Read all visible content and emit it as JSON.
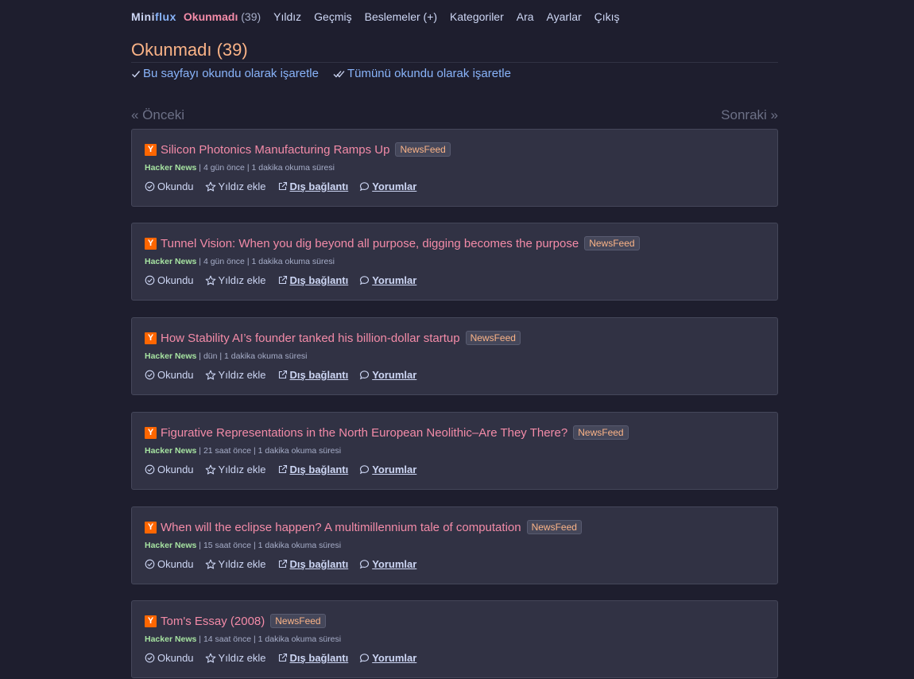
{
  "logo": {
    "part1": "Mini",
    "part2": "flux"
  },
  "nav": {
    "unread_label": "Okunmadı",
    "unread_count": "(39)",
    "items": [
      "Yıldız",
      "Geçmiş",
      "Beslemeler (+)",
      "Kategoriler",
      "Ara",
      "Ayarlar",
      "Çıkış"
    ]
  },
  "page_title": "Okunmadı (39)",
  "page_actions": [
    "Bu sayfayı okundu olarak işaretle",
    "Tümünü okundu olarak işaretle"
  ],
  "pager": {
    "prev": "« Önceki",
    "next": "Sonraki »"
  },
  "entry_icon_letter": "Y",
  "entry_actions": {
    "read": "Okundu",
    "star": "Yıldız ekle",
    "external": "Dış bağlantı",
    "comments": "Yorumlar"
  },
  "entries": [
    {
      "title": "Silicon Photonics Manufacturing Ramps Up",
      "tag": "NewsFeed",
      "feed": "Hacker News",
      "time": "4 gün önce",
      "reading": "1 dakika okuma süresi"
    },
    {
      "title": "Tunnel Vision: When you dig beyond all purpose, digging becomes the purpose",
      "tag": "NewsFeed",
      "feed": "Hacker News",
      "time": "4 gün önce",
      "reading": "1 dakika okuma süresi"
    },
    {
      "title": "How Stability AI’s founder tanked his billion-dollar startup",
      "tag": "NewsFeed",
      "feed": "Hacker News",
      "time": "dün",
      "reading": "1 dakika okuma süresi"
    },
    {
      "title": "Figurative Representations in the North European Neolithic–Are They There?",
      "tag": "NewsFeed",
      "feed": "Hacker News",
      "time": "21 saat önce",
      "reading": "1 dakika okuma süresi"
    },
    {
      "title": "When will the eclipse happen? A multimillennium tale of computation",
      "tag": "NewsFeed",
      "feed": "Hacker News",
      "time": "15 saat önce",
      "reading": "1 dakika okuma süresi"
    },
    {
      "title": "Tom's Essay (2008)",
      "tag": "NewsFeed",
      "feed": "Hacker News",
      "time": "14 saat önce",
      "reading": "1 dakika okuma süresi"
    }
  ]
}
